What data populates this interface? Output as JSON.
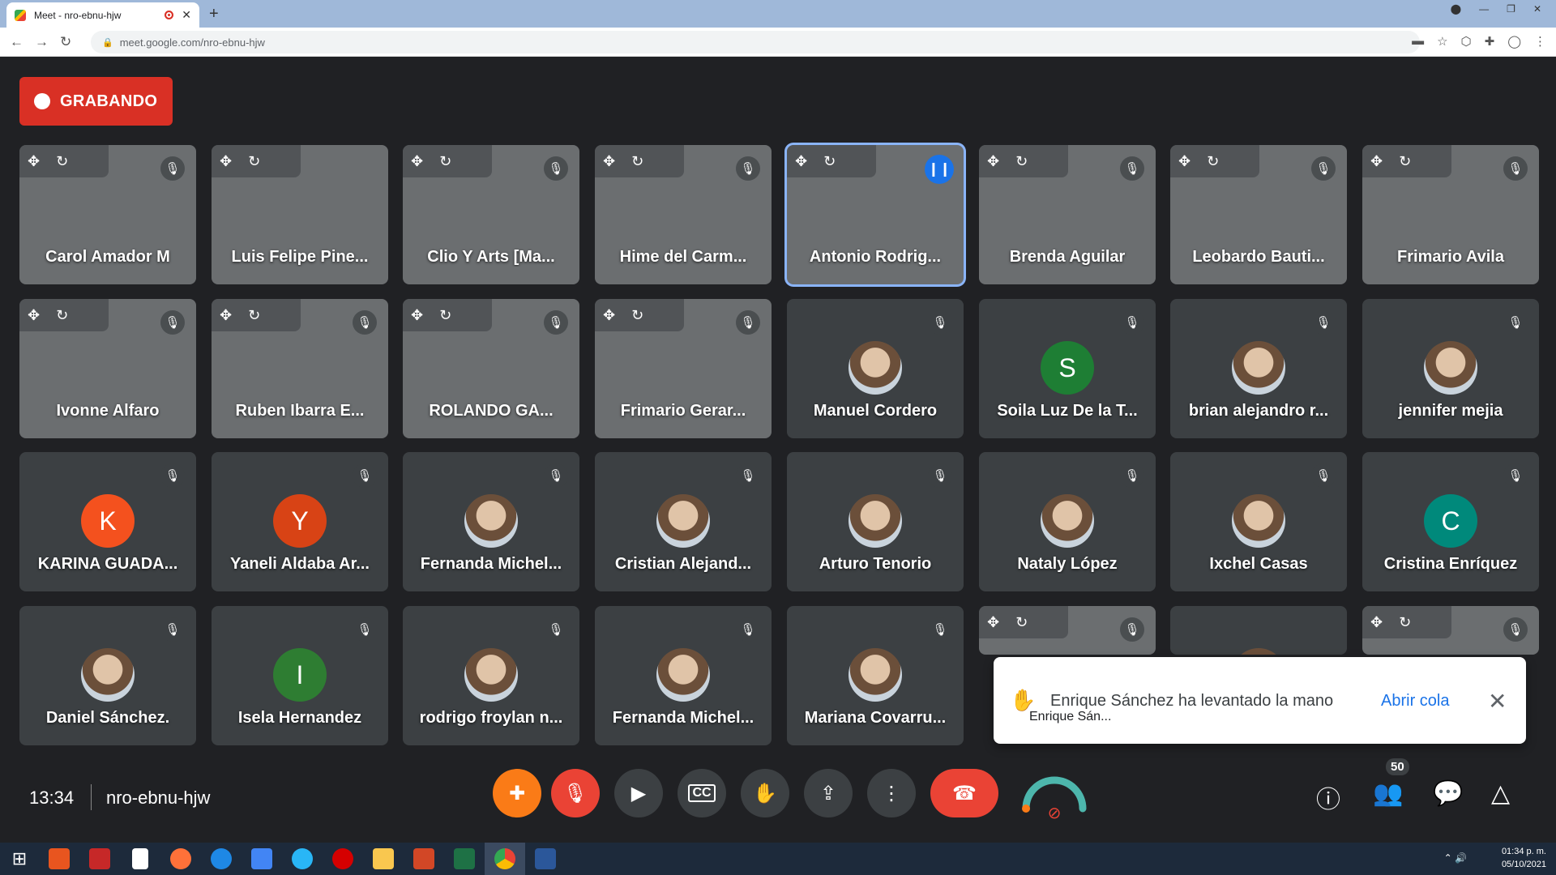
{
  "browser": {
    "tab_title": "Meet - nro-ebnu-hjw",
    "url": "meet.google.com/nro-ebnu-hjw"
  },
  "recording_label": "GRABANDO",
  "participants": [
    {
      "name": "Carol Amador M",
      "type": "video",
      "bg": "v1",
      "muted": true
    },
    {
      "name": "Luis Felipe Pine...",
      "type": "video",
      "bg": "v2",
      "muted": false
    },
    {
      "name": "Clio Y Arts [Ma...",
      "type": "video",
      "bg": "v3",
      "muted": true
    },
    {
      "name": "Hime del Carm...",
      "type": "video",
      "bg": "v4",
      "muted": true
    },
    {
      "name": "Antonio Rodrig...",
      "type": "video",
      "bg": "v5",
      "muted": false,
      "speaking": true
    },
    {
      "name": "Brenda Aguilar",
      "type": "video",
      "bg": "v6",
      "muted": true
    },
    {
      "name": "Leobardo Bauti...",
      "type": "video",
      "bg": "v7",
      "muted": true
    },
    {
      "name": "Frimario Avila",
      "type": "video",
      "bg": "v8",
      "muted": true
    },
    {
      "name": "Ivonne Alfaro",
      "type": "video",
      "bg": "v9",
      "muted": true
    },
    {
      "name": "Ruben Ibarra E...",
      "type": "video",
      "bg": "v10",
      "muted": true
    },
    {
      "name": "ROLANDO GA...",
      "type": "video",
      "bg": "v11",
      "muted": true
    },
    {
      "name": "Frimario Gerar...",
      "type": "video",
      "bg": "v12",
      "muted": true
    },
    {
      "name": "Manuel Cordero",
      "type": "photo",
      "muted": true
    },
    {
      "name": "Soila Luz De la T...",
      "type": "letter",
      "letter": "S",
      "color": "#1e7e34",
      "muted": true
    },
    {
      "name": "brian alejandro r...",
      "type": "photo",
      "muted": true
    },
    {
      "name": "jennifer mejia",
      "type": "photo",
      "muted": true
    },
    {
      "name": "KARINA GUADA...",
      "type": "letter",
      "letter": "K",
      "color": "#f4511e",
      "muted": true
    },
    {
      "name": "Yaneli Aldaba Ar...",
      "type": "letter",
      "letter": "Y",
      "color": "#d84315",
      "muted": true
    },
    {
      "name": "Fernanda Michel...",
      "type": "photo",
      "muted": true
    },
    {
      "name": "Cristian Alejand...",
      "type": "photo",
      "muted": true
    },
    {
      "name": "Arturo Tenorio",
      "type": "photo",
      "muted": true
    },
    {
      "name": "Nataly López",
      "type": "photo",
      "muted": true
    },
    {
      "name": "Ixchel Casas",
      "type": "photo",
      "muted": true
    },
    {
      "name": "Cristina Enríquez",
      "type": "letter",
      "letter": "C",
      "color": "#00897b",
      "muted": true
    },
    {
      "name": "Daniel Sánchez.",
      "type": "photo",
      "muted": true
    },
    {
      "name": "Isela Hernandez",
      "type": "letter",
      "letter": "I",
      "color": "#2e7d32",
      "muted": true
    },
    {
      "name": "rodrigo froylan n...",
      "type": "photo",
      "muted": true
    },
    {
      "name": "Fernanda Michel...",
      "type": "photo",
      "muted": true
    },
    {
      "name": "Mariana Covarru...",
      "type": "photo",
      "muted": true
    },
    {
      "name": "",
      "type": "video",
      "bg": "v13",
      "muted": true
    },
    {
      "name": "",
      "type": "photo",
      "muted": false
    },
    {
      "name": "",
      "type": "video",
      "bg": "v7",
      "muted": true
    }
  ],
  "notification": {
    "message": "Enrique Sánchez ha levantado la mano",
    "action": "Abrir cola",
    "queue_name": "Enrique Sán..."
  },
  "bottom": {
    "time": "13:34",
    "meeting_code": "nro-ebnu-hjw",
    "participant_count": "50"
  },
  "taskbar": {
    "time": "01:34 p. m.",
    "date": "05/10/2021"
  }
}
